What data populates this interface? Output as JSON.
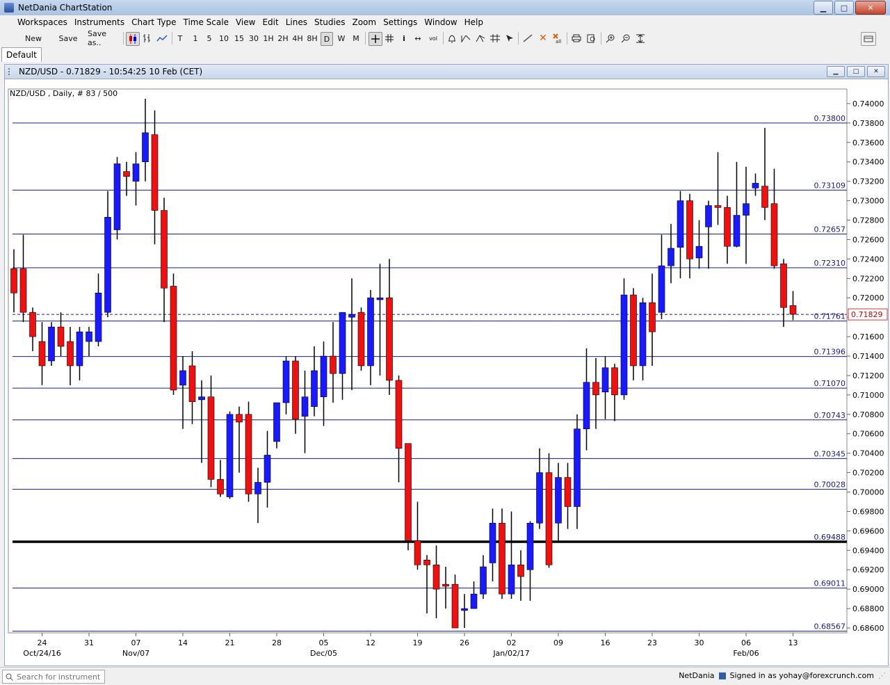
{
  "window": {
    "title": "NetDania ChartStation",
    "minimize": "▁",
    "maximize": "□",
    "close": "✕"
  },
  "menu": [
    "Workspaces",
    "Instruments",
    "Chart Type",
    "Time Scale",
    "View",
    "Edit",
    "Lines",
    "Studies",
    "Zoom",
    "Settings",
    "Window",
    "Help"
  ],
  "toolbar": {
    "new_label": "New",
    "save_label": "Save",
    "saveas_label": "Save as..",
    "timescales": [
      "T",
      "1",
      "5",
      "10",
      "15",
      "30",
      "1H",
      "2H",
      "4H",
      "8H",
      "D",
      "W",
      "M"
    ],
    "active_timescale": "D",
    "tools": [
      "crosshair-icon",
      "grid-icon",
      "info-icon",
      "arrows-icon",
      "volume-icon",
      "bell-icon",
      "trend-icon",
      "fork-icon",
      "fib-icon",
      "pointer-icon",
      "line-icon",
      "delete-icon",
      "delete-all-icon",
      "print-icon",
      "preview-icon",
      "zoom-in-icon",
      "zoom-out-icon",
      "zoom-fit-icon"
    ]
  },
  "tabs": [
    {
      "label": "Default"
    }
  ],
  "chart_window": {
    "title": "NZD/USD - 0.71829 - 10:54:25  10 Feb (CET)",
    "subtitle": "NZD/USD , Daily, # 83 / 500"
  },
  "colors": {
    "up": "#1a1aff",
    "down": "#ee1111",
    "hline": "#1a1a8c",
    "grid": "#d7d7d7"
  },
  "chart_data": {
    "type": "candlestick",
    "instrument": "NZD/USD",
    "interval": "Daily",
    "ylim": [
      0.6855,
      0.7415
    ],
    "yticks": [
      0.686,
      0.688,
      0.69,
      0.692,
      0.694,
      0.696,
      0.698,
      0.7,
      0.702,
      0.704,
      0.706,
      0.708,
      0.71,
      0.712,
      0.714,
      0.716,
      0.718,
      0.72,
      0.722,
      0.724,
      0.726,
      0.728,
      0.73,
      0.732,
      0.734,
      0.736,
      0.738,
      0.74
    ],
    "x_ticks": [
      {
        "i": 3,
        "label": "24",
        "sub": "Oct/24/16"
      },
      {
        "i": 8,
        "label": "31",
        "sub": ""
      },
      {
        "i": 13,
        "label": "07",
        "sub": "Nov/07"
      },
      {
        "i": 18,
        "label": "14",
        "sub": ""
      },
      {
        "i": 23,
        "label": "21",
        "sub": ""
      },
      {
        "i": 28,
        "label": "28",
        "sub": ""
      },
      {
        "i": 33,
        "label": "05",
        "sub": "Dec/05"
      },
      {
        "i": 38,
        "label": "12",
        "sub": ""
      },
      {
        "i": 43,
        "label": "19",
        "sub": ""
      },
      {
        "i": 48,
        "label": "26",
        "sub": ""
      },
      {
        "i": 53,
        "label": "02",
        "sub": "Jan/02/17"
      },
      {
        "i": 58,
        "label": "09",
        "sub": ""
      },
      {
        "i": 63,
        "label": "16",
        "sub": ""
      },
      {
        "i": 68,
        "label": "23",
        "sub": ""
      },
      {
        "i": 73,
        "label": "30",
        "sub": ""
      },
      {
        "i": 78,
        "label": "06",
        "sub": "Feb/06"
      },
      {
        "i": 83,
        "label": "13",
        "sub": ""
      }
    ],
    "hlines": [
      {
        "value": 0.738,
        "label": "0.73800",
        "bold": false
      },
      {
        "value": 0.73109,
        "label": "0.73109",
        "bold": false
      },
      {
        "value": 0.72657,
        "label": "0.72657",
        "bold": false
      },
      {
        "value": 0.7231,
        "label": "0.72310",
        "bold": false
      },
      {
        "value": 0.71761,
        "label": "0.71761",
        "bold": false
      },
      {
        "value": 0.71396,
        "label": "0.71396",
        "bold": false
      },
      {
        "value": 0.7107,
        "label": "0.71070",
        "bold": false
      },
      {
        "value": 0.70743,
        "label": "0.70743",
        "bold": false
      },
      {
        "value": 0.70345,
        "label": "0.70345",
        "bold": false
      },
      {
        "value": 0.70028,
        "label": "0.70028",
        "bold": false
      },
      {
        "value": 0.69488,
        "label": "0.69488",
        "bold": true
      },
      {
        "value": 0.69011,
        "label": "0.69011",
        "bold": false
      },
      {
        "value": 0.68567,
        "label": "0.68567",
        "bold": false
      }
    ],
    "last_price": {
      "value": 0.71829,
      "label": "0.71829"
    },
    "candles": [
      [
        0.723,
        0.7205,
        0.725,
        0.7185
      ],
      [
        0.723,
        0.7185,
        0.7265,
        0.7175
      ],
      [
        0.7185,
        0.716,
        0.719,
        0.7145
      ],
      [
        0.7155,
        0.713,
        0.7175,
        0.711
      ],
      [
        0.7135,
        0.717,
        0.7175,
        0.713
      ],
      [
        0.717,
        0.715,
        0.7185,
        0.714
      ],
      [
        0.7155,
        0.713,
        0.717,
        0.711
      ],
      [
        0.713,
        0.7165,
        0.717,
        0.7115
      ],
      [
        0.7155,
        0.7165,
        0.717,
        0.714
      ],
      [
        0.7155,
        0.7205,
        0.7225,
        0.715
      ],
      [
        0.7185,
        0.7283,
        0.731,
        0.718
      ],
      [
        0.727,
        0.7338,
        0.7345,
        0.726
      ],
      [
        0.733,
        0.7325,
        0.734,
        0.7305
      ],
      [
        0.732,
        0.7338,
        0.735,
        0.7295
      ],
      [
        0.734,
        0.737,
        0.7405,
        0.732
      ],
      [
        0.7368,
        0.729,
        0.7393,
        0.7255
      ],
      [
        0.729,
        0.721,
        0.7303,
        0.7175
      ],
      [
        0.7212,
        0.7105,
        0.7225,
        0.71
      ],
      [
        0.711,
        0.7125,
        0.714,
        0.7065
      ],
      [
        0.713,
        0.7093,
        0.7145,
        0.707
      ],
      [
        0.7095,
        0.7098,
        0.7115,
        0.703
      ],
      [
        0.7098,
        0.7013,
        0.712,
        0.7005
      ],
      [
        0.7013,
        0.6998,
        0.7033,
        0.6995
      ],
      [
        0.6995,
        0.708,
        0.7083,
        0.6993
      ],
      [
        0.708,
        0.7072,
        0.7088,
        0.702
      ],
      [
        0.708,
        0.6998,
        0.7093,
        0.699
      ],
      [
        0.6998,
        0.701,
        0.7025,
        0.6968
      ],
      [
        0.701,
        0.7038,
        0.7063,
        0.6984
      ],
      [
        0.7052,
        0.7092,
        0.7092,
        0.7045
      ],
      [
        0.7092,
        0.7135,
        0.714,
        0.708
      ],
      [
        0.7135,
        0.7075,
        0.714,
        0.706
      ],
      [
        0.7078,
        0.7098,
        0.7125,
        0.704
      ],
      [
        0.7088,
        0.7125,
        0.715,
        0.7078
      ],
      [
        0.7098,
        0.714,
        0.7155,
        0.7068
      ],
      [
        0.714,
        0.7122,
        0.7175,
        0.7092
      ],
      [
        0.7122,
        0.7185,
        0.7185,
        0.7095
      ],
      [
        0.718,
        0.7183,
        0.722,
        0.7105
      ],
      [
        0.7185,
        0.713,
        0.719,
        0.7125
      ],
      [
        0.713,
        0.72,
        0.7208,
        0.711
      ],
      [
        0.7198,
        0.72,
        0.7235,
        0.712
      ],
      [
        0.72,
        0.7115,
        0.724,
        0.71
      ],
      [
        0.7115,
        0.7045,
        0.712,
        0.701
      ],
      [
        0.705,
        0.695,
        0.705,
        0.694
      ],
      [
        0.695,
        0.6925,
        0.699,
        0.692
      ],
      [
        0.693,
        0.6925,
        0.6935,
        0.6875
      ],
      [
        0.6925,
        0.69,
        0.6945,
        0.687
      ],
      [
        0.6905,
        0.6903,
        0.6923,
        0.688
      ],
      [
        0.6905,
        0.686,
        0.6915,
        0.686
      ],
      [
        0.6878,
        0.688,
        0.6895,
        0.686
      ],
      [
        0.688,
        0.6895,
        0.6908,
        0.6885
      ],
      [
        0.6895,
        0.6923,
        0.6935,
        0.689
      ],
      [
        0.6927,
        0.6968,
        0.6983,
        0.6908
      ],
      [
        0.6968,
        0.6895,
        0.6983,
        0.689
      ],
      [
        0.6895,
        0.6925,
        0.698,
        0.689
      ],
      [
        0.6925,
        0.6913,
        0.694,
        0.6888
      ],
      [
        0.692,
        0.6968,
        0.697,
        0.6888
      ],
      [
        0.6968,
        0.702,
        0.7045,
        0.6962
      ],
      [
        0.702,
        0.6925,
        0.704,
        0.6922
      ],
      [
        0.6968,
        0.7015,
        0.703,
        0.695
      ],
      [
        0.7015,
        0.6985,
        0.703,
        0.6962
      ],
      [
        0.6985,
        0.7065,
        0.708,
        0.6962
      ],
      [
        0.7065,
        0.7113,
        0.7148,
        0.7043
      ],
      [
        0.7113,
        0.71,
        0.7138,
        0.7065
      ],
      [
        0.7103,
        0.7128,
        0.714,
        0.7075
      ],
      [
        0.7128,
        0.71,
        0.7132,
        0.7073
      ],
      [
        0.71,
        0.7203,
        0.722,
        0.7095
      ],
      [
        0.7203,
        0.713,
        0.721,
        0.7115
      ],
      [
        0.713,
        0.7195,
        0.72,
        0.7115
      ],
      [
        0.7195,
        0.7165,
        0.7225,
        0.713
      ],
      [
        0.7185,
        0.7233,
        0.7265,
        0.7178
      ],
      [
        0.7233,
        0.7251,
        0.7276,
        0.7215
      ],
      [
        0.7252,
        0.73,
        0.731,
        0.722
      ],
      [
        0.73,
        0.724,
        0.7307,
        0.722
      ],
      [
        0.7241,
        0.7253,
        0.728,
        0.723
      ],
      [
        0.7273,
        0.7295,
        0.73,
        0.723
      ],
      [
        0.7295,
        0.7293,
        0.735,
        0.7275
      ],
      [
        0.7293,
        0.7253,
        0.7305,
        0.7235
      ],
      [
        0.7253,
        0.7285,
        0.734,
        0.7252
      ],
      [
        0.7285,
        0.7297,
        0.7335,
        0.7235
      ],
      [
        0.7313,
        0.7318,
        0.7328,
        0.7305
      ],
      [
        0.7315,
        0.7293,
        0.7375,
        0.728
      ],
      [
        0.7297,
        0.7233,
        0.7333,
        0.723
      ],
      [
        0.7235,
        0.719,
        0.724,
        0.717
      ],
      [
        0.7192,
        0.7183,
        0.7207,
        0.7177
      ]
    ]
  },
  "status": {
    "search_placeholder": "Search for instrument",
    "brand": "NetDania",
    "signed_in": "Signed in as yohay@forexcrunch.com"
  }
}
